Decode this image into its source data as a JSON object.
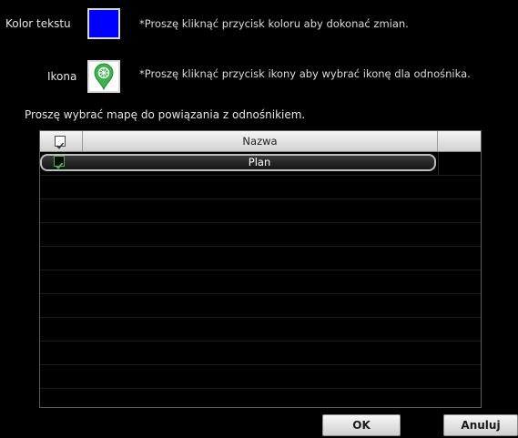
{
  "color_row": {
    "label": "Kolor tekstu",
    "hint": "*Proszę kliknąć przycisk koloru aby dokonać zmian.",
    "current_color": "#0000ff"
  },
  "icon_row": {
    "label": "Ikona",
    "hint": "*Proszę kliknąć przycisk ikony aby wybrać ikonę dla odnośnika.",
    "icon": "green-map-pin-icon"
  },
  "map_prompt": "Proszę wybrać mapę do powiązania z odnośnikiem.",
  "table": {
    "column_header": "Nazwa",
    "header_checked": true,
    "rows": [
      {
        "name": "Plan",
        "checked": true,
        "selected": true
      }
    ]
  },
  "buttons": {
    "ok_label": "OK",
    "cancel_label": "Anuluj"
  },
  "colors": {
    "background": "#000000",
    "check_green": "#4caf50",
    "icon_green": "#3cb34a"
  }
}
